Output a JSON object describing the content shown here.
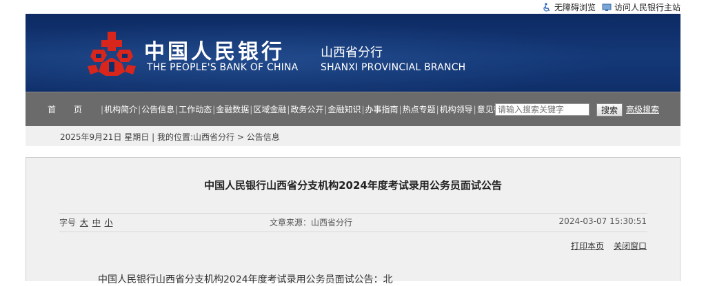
{
  "topbar": {
    "accessibility": "无障碍浏览",
    "visit_main": "访问人民银行主站"
  },
  "header": {
    "bank_name_cn": "中国人民银行",
    "branch_name_cn": "山西省分行",
    "bank_name_en": "THE PEOPLE'S BANK OF CHINA",
    "branch_name_en": "SHANXI PROVINCIAL BRANCH"
  },
  "nav": {
    "items": [
      "首页",
      "机构简介",
      "公告信息",
      "工作动态",
      "金融数据",
      "区域金融",
      "政务公开",
      "金融知识",
      "办事指南",
      "热点专题",
      "机构领导",
      "意见征集"
    ]
  },
  "search": {
    "placeholder": "请输入搜索关键字",
    "button_label": "搜索",
    "advanced_label": "高级搜索"
  },
  "breadcrumb": {
    "date": "2025年9月21日 星期日",
    "separator": "|",
    "location_label": "我的位置:",
    "path": [
      "山西省分行",
      "公告信息"
    ],
    "arrow": ">"
  },
  "article": {
    "title": "中国人民银行山西省分支机构2024年度考试录用公务员面试公告",
    "font_size_label": "字号",
    "font_sizes": [
      "大",
      "中",
      "小"
    ],
    "source_label": "文章来源：",
    "source": "山西省分行",
    "date": "2024-03-07 15:30:51",
    "print_label": "打印本页",
    "close_label": "关闭窗口",
    "body_start": "中国人民银行山西省分支机构2024年度考试录用公务员面试公告：北"
  },
  "colors": {
    "banner": "#143877",
    "nav_bg": "#6b6b6b",
    "logo_red": "#d9261c"
  }
}
